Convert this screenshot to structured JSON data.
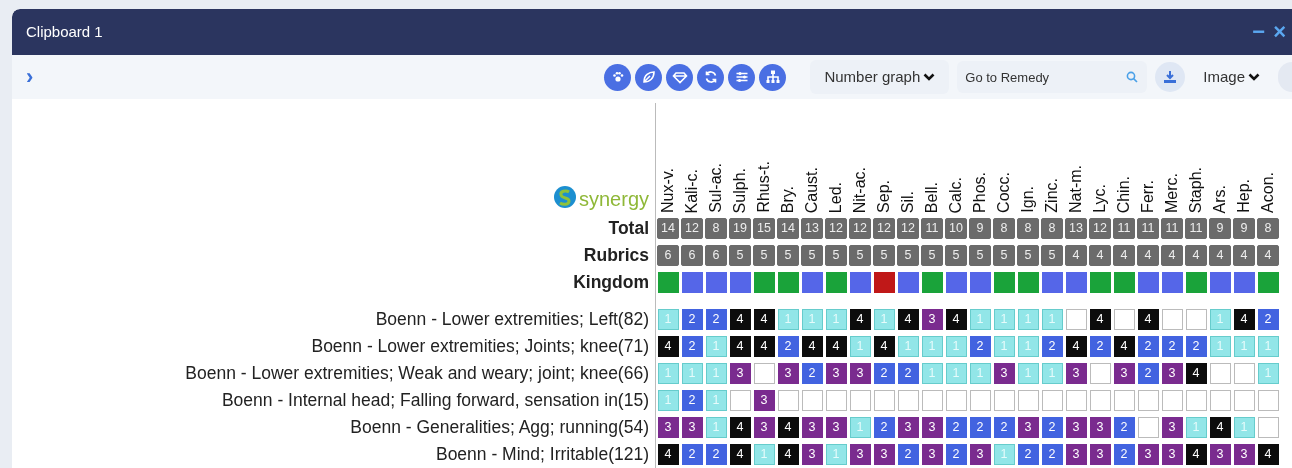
{
  "window": {
    "title": "Clipboard 1",
    "controls": [
      "−",
      "×"
    ]
  },
  "toolbar": {
    "expand": "›",
    "view_select": "Number graph",
    "search": {
      "placeholder": "Go to Remedy"
    },
    "export_select": "Image"
  },
  "logo": "synergy",
  "grid": {
    "row_labels": {
      "total": "Total",
      "rubrics": "Rubrics",
      "kingdom": "Kingdom"
    },
    "remedies": [
      "Nux-v.",
      "Kali-c.",
      "Sul-ac.",
      "Sulph.",
      "Rhus-t.",
      "Bry.",
      "Caust.",
      "Led.",
      "Nit-ac.",
      "Sep.",
      "Sil.",
      "Bell.",
      "Calc.",
      "Phos.",
      "Cocc.",
      "Ign.",
      "Zinc.",
      "Nat-m.",
      "Lyc.",
      "Chin.",
      "Ferr.",
      "Merc.",
      "Staph.",
      "Ars.",
      "Hep.",
      "Acon."
    ],
    "totals": [
      "14",
      "12",
      "8",
      "19",
      "15",
      "14",
      "13",
      "12",
      "12",
      "12",
      "12",
      "11",
      "10",
      "9",
      "8",
      "8",
      "8",
      "13",
      "12",
      "11",
      "11",
      "11",
      "11",
      "9",
      "9",
      "8"
    ],
    "rubric_counts": [
      "6",
      "6",
      "6",
      "5",
      "5",
      "5",
      "5",
      "5",
      "5",
      "5",
      "5",
      "5",
      "5",
      "5",
      "5",
      "5",
      "5",
      "4",
      "4",
      "4",
      "4",
      "4",
      "4",
      "4",
      "4",
      "4"
    ],
    "kingdom": [
      {
        "color": "#1aa33a"
      },
      {
        "color": "#5566e8"
      },
      {
        "color": "#5566e8"
      },
      {
        "color": "#5566e8"
      },
      {
        "color": "#1aa33a"
      },
      {
        "color": "#1aa33a"
      },
      {
        "color": "#5566e8"
      },
      {
        "color": "#1aa33a"
      },
      {
        "color": "#5566e8"
      },
      {
        "color": "#c01818"
      },
      {
        "color": "#5566e8"
      },
      {
        "color": "#1aa33a"
      },
      {
        "color": "#5566e8"
      },
      {
        "color": "#5566e8"
      },
      {
        "color": "#1aa33a"
      },
      {
        "color": "#1aa33a"
      },
      {
        "color": "#5566e8"
      },
      {
        "color": "#5566e8"
      },
      {
        "color": "#1aa33a"
      },
      {
        "color": "#1aa33a"
      },
      {
        "color": "#5566e8"
      },
      {
        "color": "#5566e8"
      },
      {
        "color": "#1aa33a"
      },
      {
        "color": "#5566e8"
      },
      {
        "color": "#5566e8"
      },
      {
        "color": "#1aa33a"
      }
    ],
    "rubrics": [
      {
        "label": "Boenn - Lower extremities; Left(82)",
        "cells": [
          {
            "kind": "grade",
            "value": "1"
          },
          {
            "kind": "grade",
            "value": "2"
          },
          {
            "kind": "grade",
            "value": "2"
          },
          {
            "kind": "grade",
            "value": "4"
          },
          {
            "kind": "grade",
            "value": "4"
          },
          {
            "kind": "grade",
            "value": "1"
          },
          {
            "kind": "grade",
            "value": "1"
          },
          {
            "kind": "grade",
            "value": "1"
          },
          {
            "kind": "grade",
            "value": "4"
          },
          {
            "kind": "grade",
            "value": "1"
          },
          {
            "kind": "grade",
            "value": "4"
          },
          {
            "kind": "grade",
            "value": "3"
          },
          {
            "kind": "grade",
            "value": "4"
          },
          {
            "kind": "grade",
            "value": "1"
          },
          {
            "kind": "grade",
            "value": "1"
          },
          {
            "kind": "grade",
            "value": "1"
          },
          {
            "kind": "grade",
            "value": "1"
          },
          {
            "kind": "blank"
          },
          {
            "kind": "grade",
            "value": "4"
          },
          {
            "kind": "blank"
          },
          {
            "kind": "grade",
            "value": "4"
          },
          {
            "kind": "blank"
          },
          {
            "kind": "blank"
          },
          {
            "kind": "grade",
            "value": "1"
          },
          {
            "kind": "grade",
            "value": "4"
          },
          {
            "kind": "grade",
            "value": "2"
          }
        ]
      },
      {
        "label": "Boenn - Lower extremities; Joints; knee(71)",
        "cells": [
          {
            "kind": "grade",
            "value": "4"
          },
          {
            "kind": "grade",
            "value": "2"
          },
          {
            "kind": "grade",
            "value": "1"
          },
          {
            "kind": "grade",
            "value": "4"
          },
          {
            "kind": "grade",
            "value": "4"
          },
          {
            "kind": "grade",
            "value": "2"
          },
          {
            "kind": "grade",
            "value": "4"
          },
          {
            "kind": "grade",
            "value": "4"
          },
          {
            "kind": "grade",
            "value": "1"
          },
          {
            "kind": "grade",
            "value": "4"
          },
          {
            "kind": "grade",
            "value": "1"
          },
          {
            "kind": "grade",
            "value": "1"
          },
          {
            "kind": "grade",
            "value": "1"
          },
          {
            "kind": "grade",
            "value": "2"
          },
          {
            "kind": "grade",
            "value": "1"
          },
          {
            "kind": "grade",
            "value": "1"
          },
          {
            "kind": "grade",
            "value": "2"
          },
          {
            "kind": "grade",
            "value": "4"
          },
          {
            "kind": "grade",
            "value": "2"
          },
          {
            "kind": "grade",
            "value": "4"
          },
          {
            "kind": "grade",
            "value": "2"
          },
          {
            "kind": "grade",
            "value": "2"
          },
          {
            "kind": "grade",
            "value": "2"
          },
          {
            "kind": "grade",
            "value": "1"
          },
          {
            "kind": "grade",
            "value": "1"
          },
          {
            "kind": "grade",
            "value": "1"
          }
        ]
      },
      {
        "label": "Boenn - Lower extremities; Weak and weary; joint; knee(66)",
        "cells": [
          {
            "kind": "grade",
            "value": "1"
          },
          {
            "kind": "grade",
            "value": "1"
          },
          {
            "kind": "grade",
            "value": "1"
          },
          {
            "kind": "grade",
            "value": "3"
          },
          {
            "kind": "blank"
          },
          {
            "kind": "grade",
            "value": "3"
          },
          {
            "kind": "grade",
            "value": "2"
          },
          {
            "kind": "grade",
            "value": "3"
          },
          {
            "kind": "grade",
            "value": "3"
          },
          {
            "kind": "grade",
            "value": "2"
          },
          {
            "kind": "grade",
            "value": "2"
          },
          {
            "kind": "grade",
            "value": "1"
          },
          {
            "kind": "grade",
            "value": "1"
          },
          {
            "kind": "grade",
            "value": "1"
          },
          {
            "kind": "grade",
            "value": "3"
          },
          {
            "kind": "grade",
            "value": "1"
          },
          {
            "kind": "grade",
            "value": "1"
          },
          {
            "kind": "grade",
            "value": "3"
          },
          {
            "kind": "blank"
          },
          {
            "kind": "grade",
            "value": "3"
          },
          {
            "kind": "grade",
            "value": "2"
          },
          {
            "kind": "grade",
            "value": "3"
          },
          {
            "kind": "grade",
            "value": "4"
          },
          {
            "kind": "blank"
          },
          {
            "kind": "blank"
          },
          {
            "kind": "grade",
            "value": "1"
          }
        ]
      },
      {
        "label": "Boenn - Internal head; Falling forward, sensation in(15)",
        "cells": [
          {
            "kind": "grade",
            "value": "1"
          },
          {
            "kind": "grade",
            "value": "2"
          },
          {
            "kind": "grade",
            "value": "1"
          },
          {
            "kind": "blank"
          },
          {
            "kind": "grade",
            "value": "3"
          },
          {
            "kind": "blank"
          },
          {
            "kind": "blank"
          },
          {
            "kind": "blank"
          },
          {
            "kind": "blank"
          },
          {
            "kind": "blank"
          },
          {
            "kind": "blank"
          },
          {
            "kind": "blank"
          },
          {
            "kind": "blank"
          },
          {
            "kind": "blank"
          },
          {
            "kind": "blank"
          },
          {
            "kind": "blank"
          },
          {
            "kind": "blank"
          },
          {
            "kind": "blank"
          },
          {
            "kind": "blank"
          },
          {
            "kind": "blank"
          },
          {
            "kind": "blank"
          },
          {
            "kind": "blank"
          },
          {
            "kind": "blank"
          },
          {
            "kind": "blank"
          },
          {
            "kind": "blank"
          },
          {
            "kind": "blank"
          }
        ]
      },
      {
        "label": "Boenn - Generalities; Agg; running(54)",
        "cells": [
          {
            "kind": "grade",
            "value": "3"
          },
          {
            "kind": "grade",
            "value": "3"
          },
          {
            "kind": "grade",
            "value": "1"
          },
          {
            "kind": "grade",
            "value": "4"
          },
          {
            "kind": "grade",
            "value": "3"
          },
          {
            "kind": "grade",
            "value": "4"
          },
          {
            "kind": "grade",
            "value": "3"
          },
          {
            "kind": "grade",
            "value": "3"
          },
          {
            "kind": "grade",
            "value": "1"
          },
          {
            "kind": "grade",
            "value": "2"
          },
          {
            "kind": "grade",
            "value": "3"
          },
          {
            "kind": "grade",
            "value": "3"
          },
          {
            "kind": "grade",
            "value": "2"
          },
          {
            "kind": "grade",
            "value": "2"
          },
          {
            "kind": "grade",
            "value": "2"
          },
          {
            "kind": "grade",
            "value": "3"
          },
          {
            "kind": "grade",
            "value": "2"
          },
          {
            "kind": "grade",
            "value": "3"
          },
          {
            "kind": "grade",
            "value": "3"
          },
          {
            "kind": "grade",
            "value": "2"
          },
          {
            "kind": "blank"
          },
          {
            "kind": "grade",
            "value": "3"
          },
          {
            "kind": "grade",
            "value": "1"
          },
          {
            "kind": "grade",
            "value": "4"
          },
          {
            "kind": "grade",
            "value": "1"
          },
          {
            "kind": "blank"
          }
        ]
      },
      {
        "label": "Boenn - Mind; Irritable(121)",
        "cells": [
          {
            "kind": "grade",
            "value": "4"
          },
          {
            "kind": "grade",
            "value": "2"
          },
          {
            "kind": "grade",
            "value": "2"
          },
          {
            "kind": "grade",
            "value": "4"
          },
          {
            "kind": "grade",
            "value": "1"
          },
          {
            "kind": "grade",
            "value": "4"
          },
          {
            "kind": "grade",
            "value": "3"
          },
          {
            "kind": "grade",
            "value": "1"
          },
          {
            "kind": "grade",
            "value": "3"
          },
          {
            "kind": "grade",
            "value": "3"
          },
          {
            "kind": "grade",
            "value": "2"
          },
          {
            "kind": "grade",
            "value": "3"
          },
          {
            "kind": "grade",
            "value": "2"
          },
          {
            "kind": "grade",
            "value": "3"
          },
          {
            "kind": "grade",
            "value": "1"
          },
          {
            "kind": "grade",
            "value": "2"
          },
          {
            "kind": "grade",
            "value": "2"
          },
          {
            "kind": "grade",
            "value": "3"
          },
          {
            "kind": "grade",
            "value": "3"
          },
          {
            "kind": "grade",
            "value": "2"
          },
          {
            "kind": "grade",
            "value": "3"
          },
          {
            "kind": "grade",
            "value": "3"
          },
          {
            "kind": "grade",
            "value": "4"
          },
          {
            "kind": "grade",
            "value": "3"
          },
          {
            "kind": "grade",
            "value": "3"
          },
          {
            "kind": "grade",
            "value": "4"
          }
        ]
      }
    ]
  }
}
